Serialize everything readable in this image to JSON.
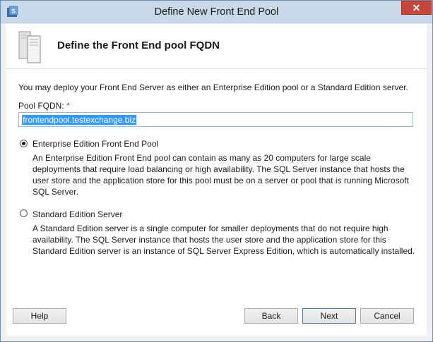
{
  "window": {
    "title": "Define New Front End Pool",
    "close_label": "✕"
  },
  "header": {
    "title": "Define the Front End pool FQDN"
  },
  "content": {
    "description": "You may deploy your Front End Server as either an Enterprise Edition pool or a Standard Edition server.",
    "pool_fqdn_label": "Pool FQDN:",
    "required_marker": "*",
    "pool_fqdn_value": "frontendpool.testexchange.biz",
    "options": [
      {
        "label": "Enterprise Edition Front End Pool",
        "selected": true,
        "description": "An Enterprise Edition Front End pool can contain as many as 20 computers for large scale deployments that require load balancing or high availability. The SQL Server instance that hosts the user store and the application store for this pool must be on a server or pool that is running Microsoft SQL Server."
      },
      {
        "label": "Standard Edition Server",
        "selected": false,
        "description": "A Standard Edition server is a single computer for smaller deployments that do not require high availability. The SQL Server instance that hosts the user store and the application store for this Standard Edition server is an instance of SQL Server Express Edition, which is automatically installed."
      }
    ]
  },
  "footer": {
    "help_label": "Help",
    "back_label": "Back",
    "next_label": "Next",
    "cancel_label": "Cancel"
  }
}
